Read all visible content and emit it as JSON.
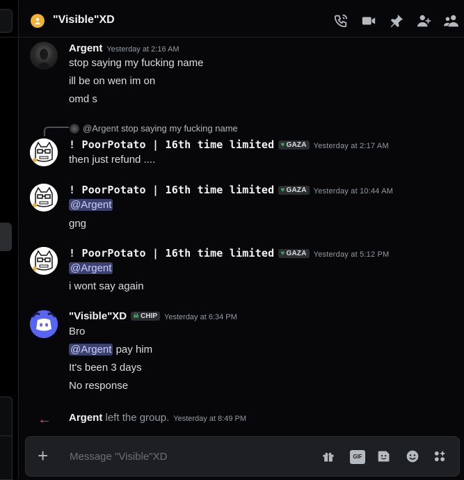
{
  "header": {
    "title": "\"Visible\"XD",
    "icons": [
      "phone-call-icon",
      "video-camera-icon",
      "pin-icon",
      "add-friend-icon",
      "members-icon"
    ]
  },
  "messages": [
    {
      "author": "Argent",
      "timestamp": "Yesterday at 2:16 AM",
      "lines": [
        "stop saying my fucking name",
        "ill  be on wen im on",
        "omd s"
      ]
    },
    {
      "reply": {
        "author": "@Argent",
        "text": "stop saying my fucking name"
      },
      "author": "! PoorPotato | 16th time limited",
      "tag": "GAZA",
      "timestamp": "Yesterday at 2:17 AM",
      "lines": [
        "then  just refund ...."
      ]
    },
    {
      "author": "! PoorPotato | 16th time limited",
      "tag": "GAZA",
      "timestamp": "Yesterday at 10:44 AM",
      "mention": "@Argent",
      "lines": [
        "gng"
      ]
    },
    {
      "author": "! PoorPotato | 16th time limited",
      "tag": "GAZA",
      "timestamp": "Yesterday at 5:12 PM",
      "mention": "@Argent",
      "lines": [
        "i wont say again"
      ]
    },
    {
      "author": "\"Visible\"XD",
      "tag": "CHIP",
      "timestamp": "Yesterday at 6:34 PM",
      "lines": [
        "Bro"
      ],
      "mention_line": {
        "mention": "@Argent",
        "text": " pay him"
      },
      "more_lines": [
        "It's been 3 days",
        "No response"
      ]
    }
  ],
  "system": {
    "author": "Argent",
    "text": " left the group.",
    "timestamp": "Yesterday at 8:49 PM"
  },
  "composer": {
    "placeholder": "Message \"Visible\"XD",
    "gif_label": "GIF",
    "icons": [
      "plus-icon",
      "gift-icon",
      "gif-icon",
      "sticker-icon",
      "emoji-icon",
      "apps-icon"
    ]
  },
  "colors": {
    "mention_bg": "#3c4270",
    "leave_arrow": "#f23f43",
    "dm_avatar": "#f0b232",
    "visible_avatar": "#5865f2"
  }
}
